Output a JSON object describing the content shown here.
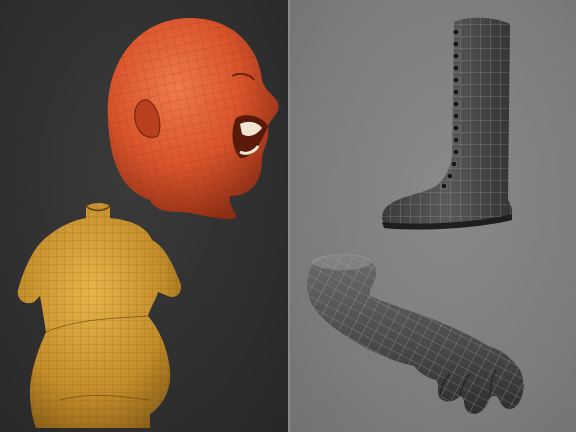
{
  "scene": {
    "panels": [
      {
        "id": "left",
        "background": "#2f2f2f",
        "models": [
          "head-model",
          "dress-model"
        ]
      },
      {
        "id": "right",
        "background": "#808080",
        "models": [
          "boot-model",
          "arm-model"
        ]
      }
    ],
    "colors": {
      "head": "#d9542b",
      "dress": "#c9962e",
      "wire_dark": "#4a4a4a",
      "wire_light": "#cfcfcf"
    }
  }
}
